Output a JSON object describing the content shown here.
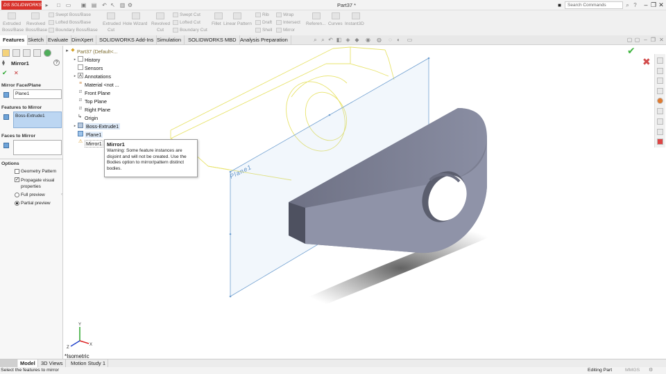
{
  "app": {
    "logo_text": "DS SOLIDWORKS",
    "document_title": "Part37 *",
    "search_placeholder": "Search Commands"
  },
  "command_manager": {
    "extruded_boss_top": "Extruded",
    "extruded_boss_bottom": "Boss/Base",
    "revolved_boss_top": "Revolved",
    "revolved_boss_bottom": "Boss/Base",
    "swept_boss": "Swept Boss/Base",
    "lofted_boss": "Lofted Boss/Base",
    "boundary_boss": "Boundary Boss/Base",
    "extruded_cut_top": "Extruded",
    "extruded_cut_bottom": "Cut",
    "hole_wizard": "Hole Wizard",
    "revolved_cut_top": "Revolved",
    "revolved_cut_bottom": "Cut",
    "swept_cut": "Swept Cut",
    "lofted_cut": "Lofted Cut",
    "boundary_cut": "Boundary Cut",
    "fillet": "Fillet",
    "linear_pattern": "Linear Pattern",
    "rib": "Rib",
    "draft": "Draft",
    "shell": "Shell",
    "wrap": "Wrap",
    "intersect": "Intersect",
    "mirror": "Mirror",
    "reference": "Referen...",
    "curves": "Curves",
    "instant3d": "Instant3D"
  },
  "tabs": [
    "Features",
    "Sketch",
    "Evaluate",
    "DimXpert",
    "SOLIDWORKS Add-Ins",
    "Simulation",
    "SOLIDWORKS MBD",
    "Analysis Preparation"
  ],
  "property_manager": {
    "title": "Mirror1",
    "ok_symbol": "✔",
    "cancel_symbol": "✕",
    "help_symbol": "?",
    "mirror_face_label": "Mirror Face/Plane",
    "mirror_face_value": "Plane1",
    "features_label": "Features to Mirror",
    "features_value": "Boss-Extrude1",
    "faces_label": "Faces to Mirror",
    "options_label": "Options",
    "geometry_pattern": "Geometry Pattern",
    "propagate_visual": "Propagate visual properties",
    "full_preview": "Full preview",
    "partial_preview": "Partial preview"
  },
  "tree": {
    "root": "Part37  (Default<...",
    "items": [
      "History",
      "Sensors",
      "Annotations",
      "Material <not ...",
      "Front Plane",
      "Top Plane",
      "Right Plane",
      "Origin",
      "Boss-Extrude1",
      "Plane1",
      "Mirror1"
    ]
  },
  "tooltip": {
    "title": "Mirror1",
    "body": "Warning: Some feature instances are disjoint and will not be created. Use the Bodies option to mirror/pattern distinct bodies."
  },
  "viewport": {
    "plane_label": "Plane1",
    "view_name": "*Isometric"
  },
  "bottom_tabs": [
    "Model",
    "3D Views",
    "Motion Study 1"
  ],
  "status": {
    "left": "Select the features to mirror",
    "mode": "Editing Part",
    "units": "MMGS"
  },
  "colors": {
    "logo_red": "#d8322b",
    "preview_yellow": "#e8e36a",
    "plane_blue": "#6f9fd0",
    "part_gray": "#7c7f92",
    "ok_green": "#27a52b",
    "cancel_red": "#c22b2b"
  }
}
